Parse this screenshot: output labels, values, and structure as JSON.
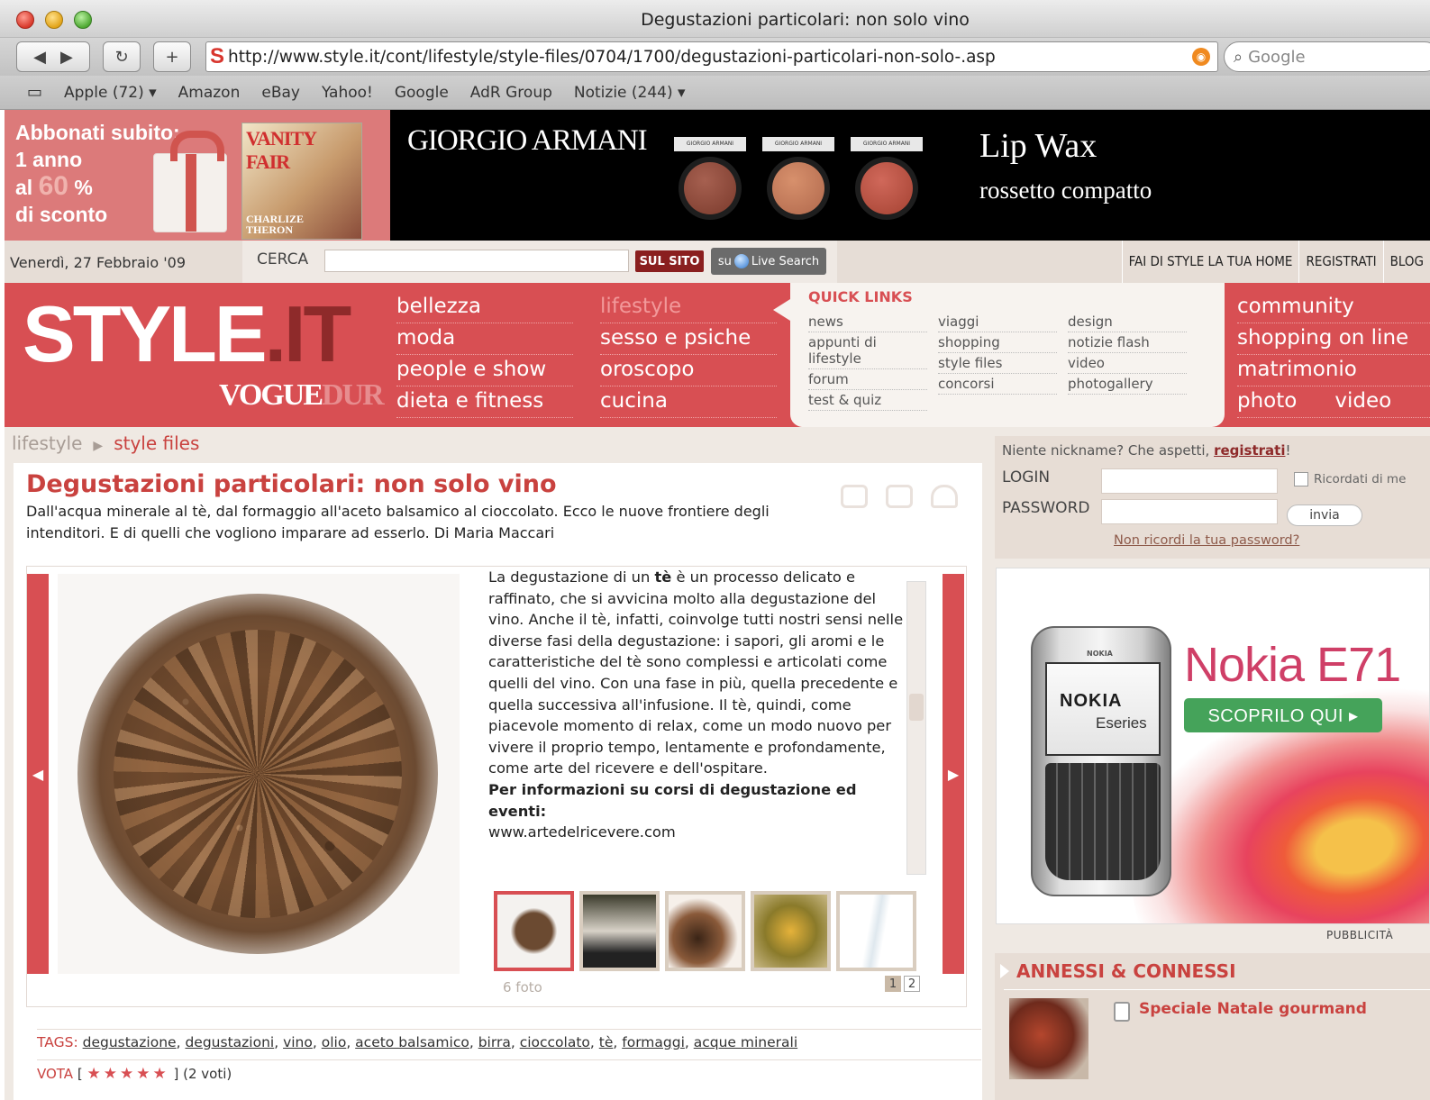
{
  "browser": {
    "window_title": "Degustazioni particolari: non solo vino",
    "url": "http://www.style.it/cont/lifestyle/style-files/0704/1700/degustazioni-particolari-non-solo-.asp",
    "search_placeholder": "Google",
    "bookmarks": [
      "Apple (72) ▾",
      "Amazon",
      "eBay",
      "Yahoo!",
      "Google",
      "AdR Group",
      "Notizie (244) ▾"
    ]
  },
  "banner": {
    "vf_line1": "Abbonati subito:",
    "vf_line2": "1 anno",
    "vf_line3_a": "al ",
    "vf_line3_b": "60",
    "vf_line3_c": " %",
    "vf_line4": "di sconto",
    "vf_mast": "VANITY FAIR",
    "vf_cover_name": "CHARLIZE THERON",
    "armani_brand": "GIORGIO ARMANI",
    "lip_title": "Lip Wax",
    "lip_subtitle": "rossetto compatto",
    "compact_label": "GIORGIO ARMANI",
    "compact_colors": [
      "#7a3a2c",
      "#b0684c",
      "#a44232"
    ]
  },
  "topbar": {
    "date": "Venerdì, 27 Febbraio '09",
    "cerca_label": "CERCA",
    "btn_sul_sito": "SUL SITO",
    "btn_live_prefix": "su",
    "btn_live_label": "Live Search",
    "links": [
      "FAI DI STYLE LA TUA HOME",
      "REGISTRATI",
      "BLOG"
    ]
  },
  "nav": {
    "logo_main": "STYLE",
    "logo_it": ".IT",
    "vogue": "VOGUE",
    "vogue_dur": "DUR",
    "col1": [
      "bellezza",
      "moda",
      "people e show",
      "dieta e fitness"
    ],
    "col2": [
      "lifestyle",
      "sesso e psiche",
      "oroscopo",
      "cucina"
    ],
    "quick_links_title": "QUICK LINKS",
    "ql_col1": [
      "news",
      "appunti di lifestyle",
      "forum",
      "test & quiz"
    ],
    "ql_col2": [
      "viaggi",
      "shopping",
      "style files",
      "concorsi"
    ],
    "ql_col3": [
      "design",
      "notizie flash",
      "video",
      "photogallery"
    ],
    "col4": [
      "community",
      "shopping on line",
      "matrimonio"
    ],
    "col4_last": [
      "photo",
      "video"
    ]
  },
  "breadcrumb": {
    "parent": "lifestyle",
    "current": "style files"
  },
  "article": {
    "title": "Degustazioni particolari: non solo vino",
    "lead": "Dall'acqua minerale al tè, dal formaggio all'aceto balsamico al cioccolato. Ecco le nuove frontiere degli intenditori. E di quelli che vogliono imparare ad esserlo. Di Maria Maccari",
    "body_1": "La degustazione di un ",
    "body_bold": "tè",
    "body_2": " è un processo delicato e raffinato, che si avvicina molto alla degustazione del vino. Anche il tè, infatti, coinvolge tutti nostri sensi nelle diverse fasi della degustazione: i sapori, gli aromi e le caratteristiche del tè sono complessi e articolati come quelli del vino. Con una fase in più, quella precedente e quella successiva all'infusione. Il tè, quindi, come piacevole momento di relax, come un modo nuovo per vivere il proprio tempo, lentamente e profondamente, come arte del ricevere e dell'ospitare.",
    "info_bold": "Per informazioni su corsi di degustazione ed eventi:",
    "info_link": "www.artedelricevere.com",
    "photo_count": "6 foto",
    "pages": [
      "1",
      "2"
    ],
    "tags_label": "TAGS:",
    "tags": [
      "degustazione",
      "degustazioni",
      "vino",
      "olio",
      "aceto balsamico",
      "birra",
      "cioccolato",
      "tè",
      "formaggi",
      "acque minerali"
    ],
    "vota_label": "VOTA",
    "vota_open": "[",
    "stars": "★★★★★",
    "rating": 5,
    "vota_close": "]",
    "votes": "(2 voti)"
  },
  "login": {
    "question": "Niente nickname? Che aspetti, ",
    "register": "registrati",
    "question_end": "!",
    "login_label": "LOGIN",
    "password_label": "PASSWORD",
    "remember": "Ricordati di me",
    "submit": "invia",
    "forgot": "Non ricordi la tua password?"
  },
  "ad_nokia": {
    "title": "Nokia E71",
    "cta": "SCOPRILO QUI ▸",
    "screen_brand": "NOKIA",
    "screen_series": "Eseries",
    "phone_logo": "NOKIA"
  },
  "pubblicita": "PUBBLICITÀ",
  "annessi": {
    "title": "ANNESSI & CONNESSI",
    "link": "Speciale Natale gourmand"
  }
}
